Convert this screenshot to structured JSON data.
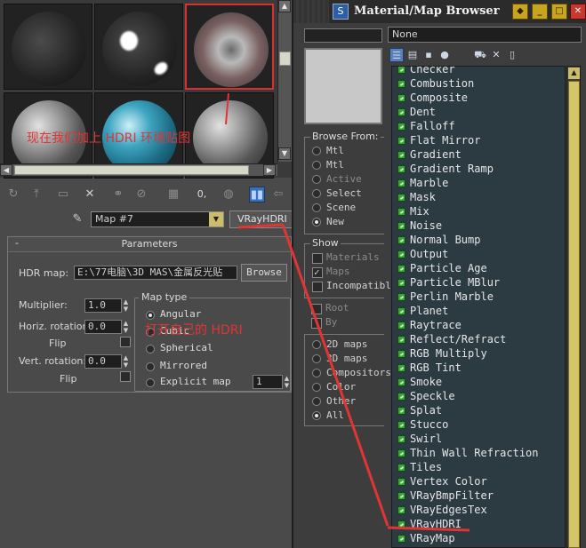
{
  "annotations": {
    "top": "现在我们加上 HDRI 环境贴图",
    "middle": "打开自己的 HDRI"
  },
  "editor": {
    "map_name": "Map #7",
    "map_type_button": "VRayHDRI",
    "rollout_minus": "-",
    "rollout_title": "Parameters",
    "hdr_map_label": "HDR map:",
    "hdr_map_path": "E:\\77电脑\\3D MAS\\金属反光贴",
    "browse_label": "Browse",
    "multiplier_label": "Multiplier:",
    "multiplier_value": "1.0",
    "horiz_rotation_label": "Horiz. rotation:",
    "horiz_rotation_value": "0.0",
    "flip_label_1": "Flip",
    "vert_rotation_label": "Vert. rotation:",
    "vert_rotation_value": "0.0",
    "flip_label_2": "Flip",
    "map_type_group": "Map type",
    "map_types": [
      "Angular",
      "Cubic",
      "Spherical",
      "Mirrored",
      "Explicit map"
    ],
    "selected_map_type": "Angular",
    "explicit_value": "1",
    "toolbar_zero": "0,"
  },
  "browser": {
    "title": "Material/Map Browser",
    "search_value": "None",
    "browse_from_title": "Browse From:",
    "browse_from": [
      "Mtl",
      "Mtl",
      "Active",
      "Select",
      "Scene",
      "New"
    ],
    "browse_from_selected": "New",
    "show_title": "Show",
    "show_options": [
      "Materials",
      "Maps",
      "Incompatible"
    ],
    "show_options_2": [
      "Root",
      "By"
    ],
    "map_filters": [
      "2D maps",
      "3D maps",
      "Compositors",
      "Color",
      "Other",
      "All"
    ],
    "map_filter_selected": "All",
    "items": [
      "Checker",
      "Combustion",
      "Composite",
      "Dent",
      "Falloff",
      "Flat Mirror",
      "Gradient",
      "Gradient Ramp",
      "Marble",
      "Mask",
      "Mix",
      "Noise",
      "Normal Bump",
      "Output",
      "Particle Age",
      "Particle MBlur",
      "Perlin Marble",
      "Planet",
      "Raytrace",
      "Reflect/Refract",
      "RGB Multiply",
      "RGB Tint",
      "Smoke",
      "Speckle",
      "Splat",
      "Stucco",
      "Swirl",
      "Thin Wall Refraction",
      "Tiles",
      "Vertex Color",
      "VRayBmpFilter",
      "VRayEdgesTex",
      "VRayHDRI",
      "VRayMap"
    ]
  },
  "colors": {
    "annotation_red": "#e03535",
    "list_bg": "#2c3a42",
    "accent_gold": "#c7a521"
  }
}
